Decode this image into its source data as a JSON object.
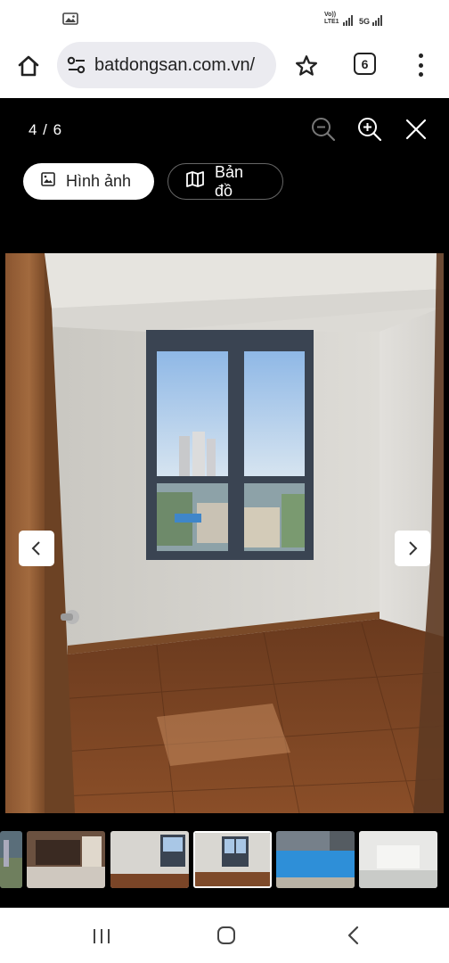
{
  "status_bar": {
    "network_label": "Vo)) LTE1",
    "network_type": "5G",
    "notification_icon": "gallery-icon"
  },
  "browser": {
    "url": "batdongsan.com.vn/",
    "tab_count": "6",
    "icons": [
      "home-icon",
      "tune-icon",
      "star-icon",
      "tabs-icon",
      "more-vert-icon"
    ]
  },
  "viewer": {
    "counter": "4 / 6",
    "current_index": 4,
    "total": 6,
    "tabs": [
      {
        "label": "Hình ảnh",
        "icon": "image-icon",
        "selected": true
      },
      {
        "label": "Bản đồ",
        "icon": "map-icon",
        "selected": false
      }
    ],
    "controls": [
      "zoom-out-icon",
      "zoom-in-icon",
      "close-icon"
    ],
    "thumbnails": [
      {
        "subject": "aerial-city",
        "active": false
      },
      {
        "subject": "lobby",
        "active": false
      },
      {
        "subject": "empty-room",
        "active": false
      },
      {
        "subject": "bedroom-window",
        "active": true
      },
      {
        "subject": "swimming-pool",
        "active": false
      },
      {
        "subject": "hallway",
        "active": false
      }
    ]
  },
  "nav_bar": {
    "icons": [
      "recents-icon",
      "home-icon",
      "back-icon"
    ]
  }
}
